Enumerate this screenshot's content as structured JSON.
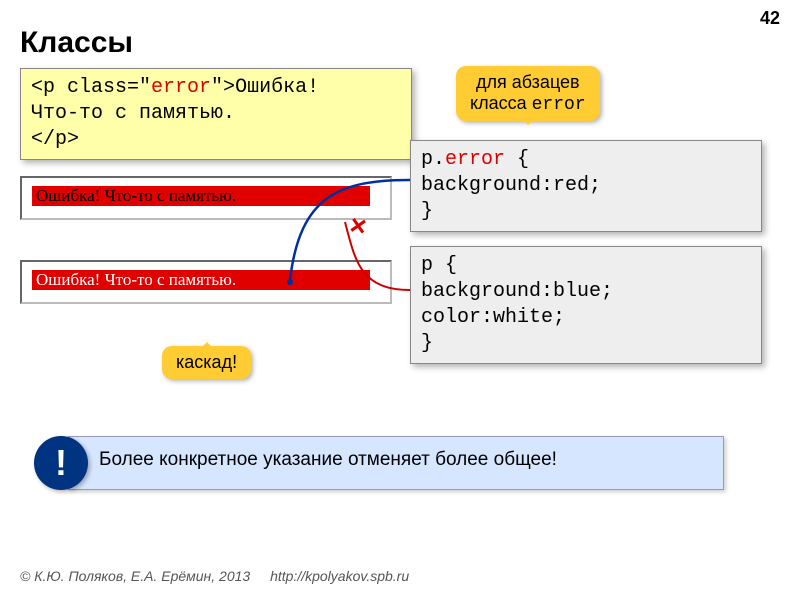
{
  "page_number": "42",
  "title": "Классы",
  "code_html": {
    "open_tag_pre": "<p class=\"",
    "class_name": "error",
    "open_tag_post": "\">",
    "content_line1": "Ошибка!",
    "content_line2": "Что-то с памятью.",
    "close_tag": "</p>"
  },
  "callout_top_line1": "для абзацев",
  "callout_top_line2_pre": "класса ",
  "callout_top_line2_mono": "error",
  "css_block1": {
    "selector_pre": "p.",
    "selector_class": "error",
    "selector_post": " {",
    "rule1": "  background:red;",
    "close": "}"
  },
  "css_block2": {
    "selector": "p {",
    "rule1": "  background:blue;",
    "rule2": "  color:white;",
    "close": "}"
  },
  "preview1_text": "Ошибка! Что-то с памятью.",
  "preview2_text": "Ошибка! Что-то с памятью.",
  "callout_cascade": "каскад!",
  "note_icon": "!",
  "note_text": "Более конкретное указание отменяет более общее!",
  "footer_copyright": "© К.Ю. Поляков, Е.А. Ерёмин, 2013",
  "footer_link": "http://kpolyakov.spb.ru",
  "x_mark": "×"
}
